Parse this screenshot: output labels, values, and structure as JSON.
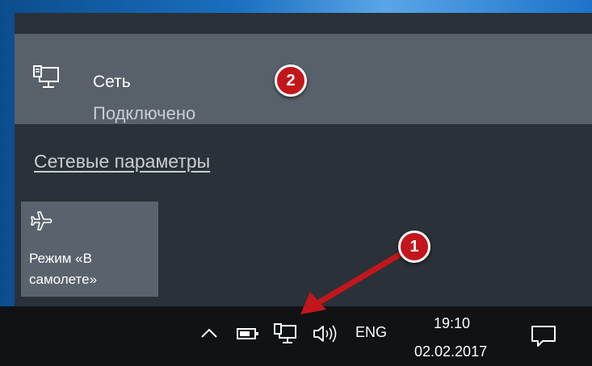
{
  "network": {
    "name": "Сеть",
    "status": "Подключено",
    "icon": "network-computer-icon"
  },
  "links": {
    "settings": "Сетевые параметры"
  },
  "quick_actions": {
    "airplane_label": "Режим «В самолете»",
    "airplane_icon": "airplane-icon"
  },
  "annotations": {
    "badge_1": "1",
    "badge_2": "2",
    "badge_color": "#c3161c"
  },
  "taskbar": {
    "language": "ENG",
    "time": "19:10",
    "date": "02.02.2017",
    "icons": [
      "chevron-up-icon",
      "battery-icon",
      "network-icon",
      "volume-icon",
      "action-center-icon"
    ]
  }
}
